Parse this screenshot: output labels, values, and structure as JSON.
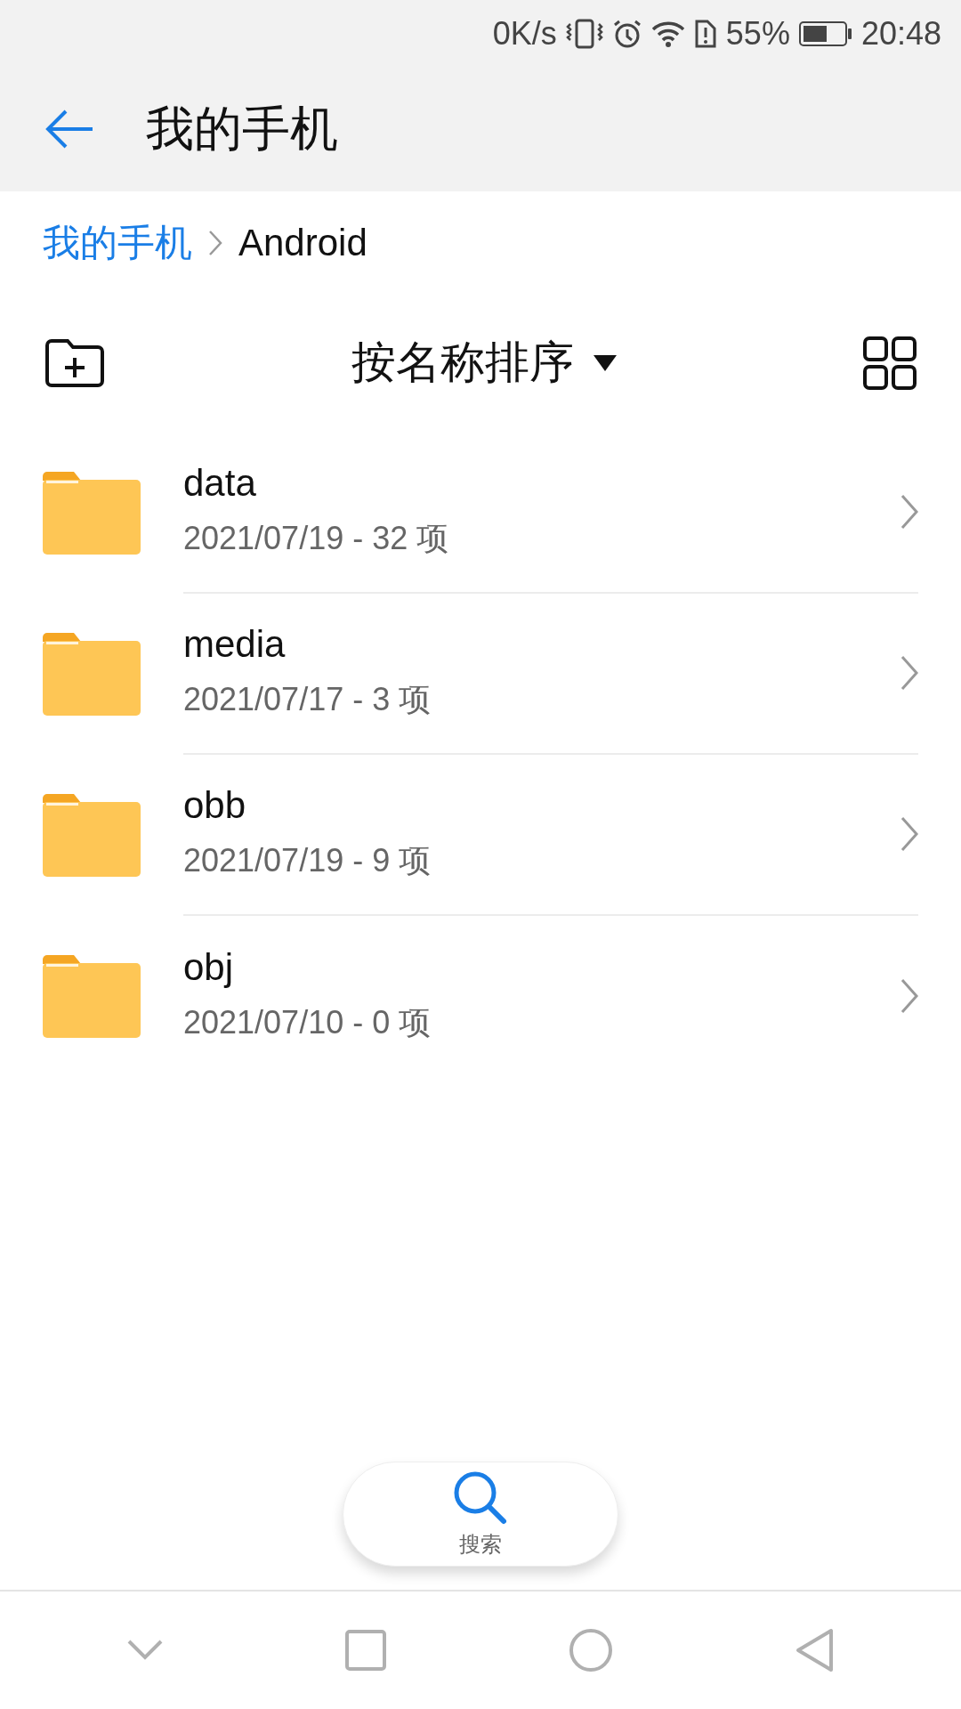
{
  "status_bar": {
    "speed": "0K/s",
    "battery": "55%",
    "time": "20:48"
  },
  "header": {
    "title": "我的手机"
  },
  "breadcrumb": [
    {
      "label": "我的手机",
      "selected": false
    },
    {
      "label": "Android",
      "selected": true
    }
  ],
  "toolbar": {
    "sort": "按名称排序"
  },
  "files": [
    {
      "name": "data",
      "meta": "2021/07/19 - 32 项"
    },
    {
      "name": "media",
      "meta": "2021/07/17 - 3 项"
    },
    {
      "name": "obb",
      "meta": "2021/07/19 - 9 项"
    },
    {
      "name": "obj",
      "meta": "2021/07/10 - 0 项"
    }
  ],
  "search_button": {
    "label": "搜索"
  }
}
